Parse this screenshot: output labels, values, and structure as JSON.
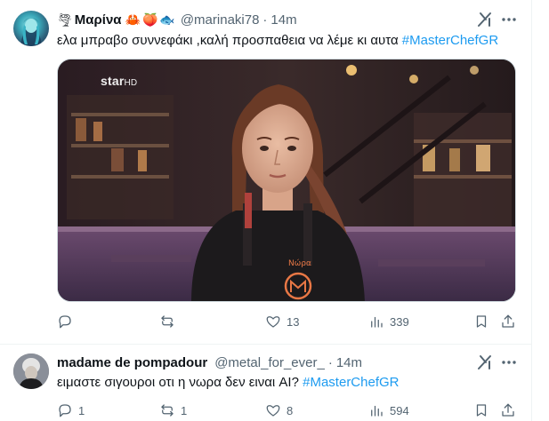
{
  "tweets": [
    {
      "name": "Μαρίνα",
      "emojis": [
        "🌪",
        "🦀",
        "🍑",
        "🐟"
      ],
      "handle": "@marinaki78",
      "separator": "·",
      "time": "14m",
      "text": "ελα μπραβο συννεφάκι ,καλή προσπαθεια να λέμε κι αυτα",
      "hashtag": "#MasterChefGR",
      "media": {
        "channel_logo": "star",
        "channel_logo_suffix": "HD",
        "apron_name": "Νώρα"
      },
      "actions": {
        "replies": "",
        "reposts": "",
        "likes": "13",
        "views": "339"
      }
    },
    {
      "name": "madame de pompadour",
      "handle": "@metal_for_ever_",
      "separator": "·",
      "time": "14m",
      "text": "ειμαστε σιγουροι οτι η νωρα δεν ειναι AI?",
      "hashtag": "#MasterChefGR",
      "actions": {
        "replies": "1",
        "reposts": "1",
        "likes": "8",
        "views": "594"
      }
    }
  ],
  "colors": {
    "link": "#1d9bf0",
    "secondary_text": "#536471",
    "primary_text": "#0f1419",
    "divider": "#eff3f4"
  },
  "icons": [
    "grok-icon",
    "more-icon",
    "reply-icon",
    "repost-icon",
    "like-icon",
    "views-icon",
    "bookmark-icon",
    "share-icon"
  ]
}
